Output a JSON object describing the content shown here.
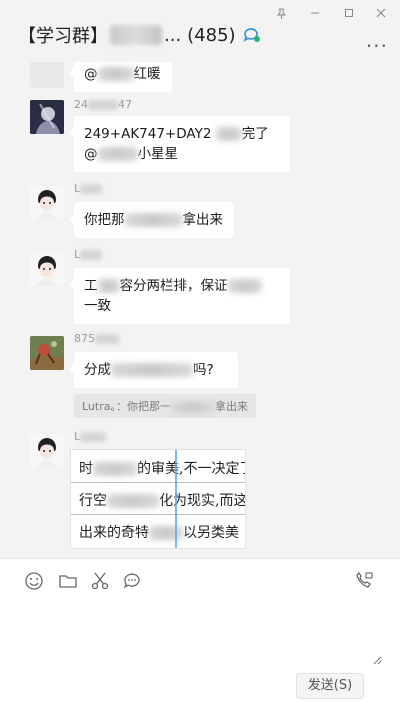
{
  "window": {
    "title_prefix": "【学习群】",
    "title_suffix": "...",
    "member_count": "(485)",
    "more": "···"
  },
  "messages": [
    {
      "type": "bubble",
      "text_parts": [
        "@",
        "",
        "红暖"
      ]
    },
    {
      "type": "bubble",
      "sender": "24",
      "sender_tail": "47",
      "line1": [
        "249+AK747+DAY2 ",
        "",
        "完了"
      ],
      "line2": [
        "@",
        "",
        "小星星"
      ]
    },
    {
      "type": "bubble",
      "sender": "L",
      "text_parts": [
        "你把那",
        "",
        "拿出来"
      ]
    },
    {
      "type": "bubble",
      "sender": "L",
      "line1": [
        "工",
        "",
        "容分两栏排，保证",
        ""
      ],
      "line2": [
        "一致"
      ]
    },
    {
      "type": "bubble",
      "sender": "875",
      "text_parts": [
        "分成",
        "",
        "吗?"
      ],
      "quote_parts": [
        "Lutra。：你把那一",
        "",
        "拿出来"
      ]
    },
    {
      "type": "image",
      "sender": "L",
      "lines": [
        [
          "时",
          "",
          "的审美,不一决定了"
        ],
        [
          "行空",
          "",
          "化为现实,而这"
        ],
        [
          "出来的奇特",
          "",
          "以另类美"
        ]
      ]
    }
  ],
  "composer": {
    "tools": [
      "emoji-icon",
      "folder-icon",
      "scissors-icon",
      "chat-history-icon",
      "video-call-icon"
    ],
    "send_label": "发送(S)"
  }
}
